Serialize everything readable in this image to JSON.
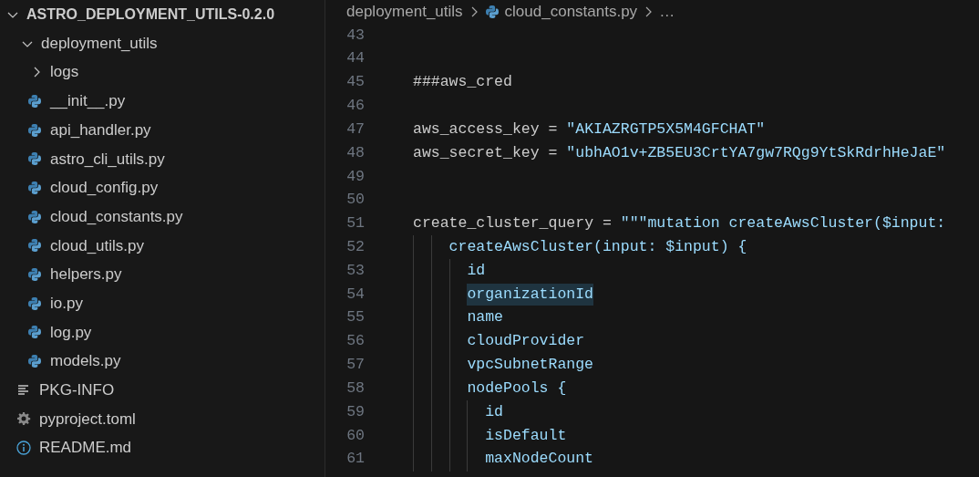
{
  "explorer": {
    "title": "ASTRO_DEPLOYMENT_UTILS-0.2.0",
    "expanded": true,
    "items": [
      {
        "label": "deployment_utils",
        "kind": "folder",
        "expanded": true,
        "children": [
          {
            "label": "logs",
            "kind": "folder",
            "expanded": false
          },
          {
            "label": "__init__.py",
            "kind": "python"
          },
          {
            "label": "api_handler.py",
            "kind": "python"
          },
          {
            "label": "astro_cli_utils.py",
            "kind": "python"
          },
          {
            "label": "cloud_config.py",
            "kind": "python"
          },
          {
            "label": "cloud_constants.py",
            "kind": "python"
          },
          {
            "label": "cloud_utils.py",
            "kind": "python"
          },
          {
            "label": "helpers.py",
            "kind": "python"
          },
          {
            "label": "io.py",
            "kind": "python"
          },
          {
            "label": "log.py",
            "kind": "python"
          },
          {
            "label": "models.py",
            "kind": "python"
          }
        ]
      },
      {
        "label": "PKG-INFO",
        "kind": "text"
      },
      {
        "label": "pyproject.toml",
        "kind": "settings"
      },
      {
        "label": "README.md",
        "kind": "info"
      }
    ]
  },
  "breadcrumb": [
    {
      "label": "deployment_utils",
      "kind": "folder"
    },
    {
      "label": "cloud_constants.py",
      "kind": "python"
    },
    {
      "label": "…",
      "kind": "more"
    }
  ],
  "code": [
    {
      "number": "43"
    },
    {
      "number": "44"
    },
    {
      "number": "45",
      "tokens": [
        {
          "text": "###aws_cred",
          "kind": "text"
        }
      ]
    },
    {
      "number": "46"
    },
    {
      "number": "47",
      "tokens": [
        {
          "text": "aws_access_key = ",
          "kind": "text"
        },
        {
          "text": "\"AKIAZRGTP5X5M4GFCHAT\"",
          "kind": "string"
        }
      ]
    },
    {
      "number": "48",
      "tokens": [
        {
          "text": "aws_secret_key = ",
          "kind": "text"
        },
        {
          "text": "\"ubhAO1v+ZB5EU3CrtYA7gw7RQg9YtSkRdrhHeJaE\"",
          "kind": "string"
        }
      ]
    },
    {
      "number": "49"
    },
    {
      "number": "50"
    },
    {
      "number": "51",
      "tokens": [
        {
          "text": "create_cluster_query = ",
          "kind": "text"
        },
        {
          "text": "\"\"\"mutation createAwsCluster($input:",
          "kind": "string"
        }
      ]
    },
    {
      "number": "52",
      "tokens": [
        {
          "text": "    createAwsCluster(input: $input) {",
          "kind": "string"
        }
      ]
    },
    {
      "number": "53",
      "tokens": [
        {
          "text": "      id",
          "kind": "string"
        }
      ]
    },
    {
      "number": "54",
      "tokens": [
        {
          "text": "      organizationId",
          "kind": "string",
          "highlighted": true
        }
      ]
    },
    {
      "number": "55",
      "tokens": [
        {
          "text": "      name",
          "kind": "string"
        }
      ]
    },
    {
      "number": "56",
      "tokens": [
        {
          "text": "      cloudProvider",
          "kind": "string"
        }
      ]
    },
    {
      "number": "57",
      "tokens": [
        {
          "text": "      vpcSubnetRange",
          "kind": "string"
        }
      ]
    },
    {
      "number": "58",
      "tokens": [
        {
          "text": "      nodePools {",
          "kind": "string"
        }
      ]
    },
    {
      "number": "59",
      "tokens": [
        {
          "text": "        id",
          "kind": "string"
        }
      ]
    },
    {
      "number": "60",
      "tokens": [
        {
          "text": "        isDefault",
          "kind": "string"
        }
      ]
    },
    {
      "number": "61",
      "tokens": [
        {
          "text": "        maxNodeCount",
          "kind": "string"
        }
      ]
    }
  ]
}
